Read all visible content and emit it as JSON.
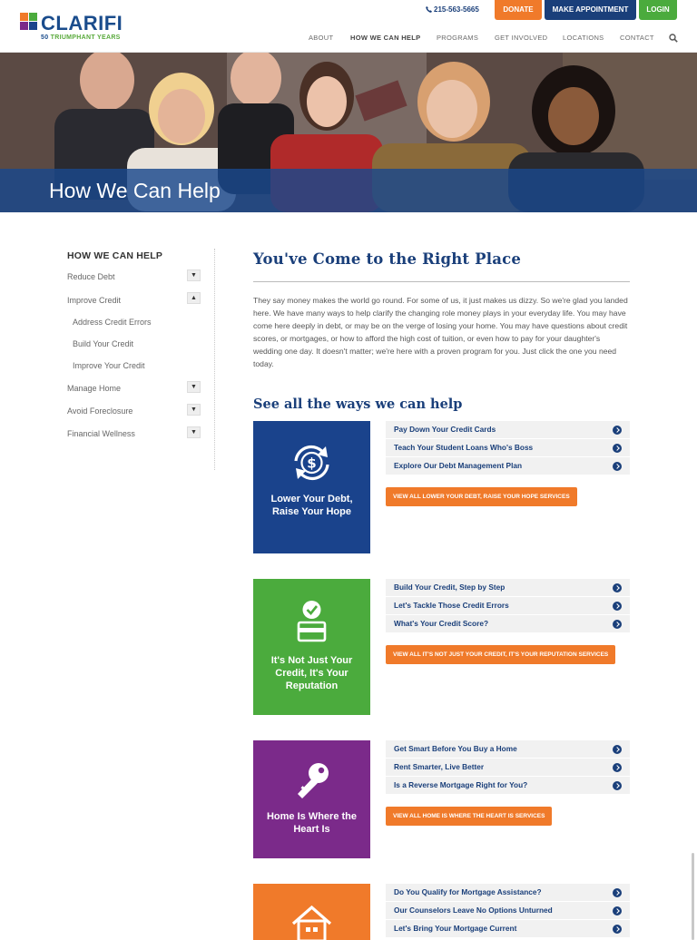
{
  "header": {
    "logo_text": "CLARIFI",
    "logo_sub_num": "50",
    "logo_sub_text": "TRIUMPHANT YEARS",
    "phone": "215-563-5665",
    "donate": "DONATE",
    "appointment": "MAKE APPOINTMENT",
    "login": "LOGIN",
    "nav": [
      "ABOUT",
      "HOW WE CAN HELP",
      "PROGRAMS",
      "GET INVOLVED",
      "LOCATIONS",
      "CONTACT"
    ],
    "colors": {
      "brand": "#1a3f7a",
      "orange": "#f07a2a",
      "green": "#4bab3d"
    }
  },
  "hero": {
    "title": "How We Can Help"
  },
  "sidebar": {
    "title": "HOW WE CAN HELP",
    "items": [
      {
        "label": "Reduce Debt",
        "toggle": "▼"
      },
      {
        "label": "Improve Credit",
        "toggle": "▲"
      },
      {
        "label": "Address Credit Errors"
      },
      {
        "label": "Build Your Credit"
      },
      {
        "label": "Improve Your Credit"
      },
      {
        "label": "Manage Home",
        "toggle": "▼"
      },
      {
        "label": "Avoid Foreclosure",
        "toggle": "▼"
      },
      {
        "label": "Financial Wellness",
        "toggle": "▼"
      }
    ]
  },
  "main": {
    "title": "You've Come to the Right Place",
    "intro": "They say money makes the world go round. For some of us, it just makes us dizzy. So we're glad you landed here. We have many ways to help clarify the changing role money plays in your everyday life. You may have come here deeply in debt, or may be on the verge of losing your home. You may have questions about credit scores, or mortgages, or how to afford the high cost of tuition, or even how to pay for your daughter's wedding one day. It doesn't matter; we're here with a proven program for you. Just click the one you need today.",
    "ways_title": "See all the ways we can help",
    "cards": [
      {
        "label": "Lower Your Debt, Raise Your Hope",
        "icon": "dollar-cycle-icon",
        "color": "#1a438c",
        "links": [
          "Pay Down Your Credit Cards",
          "Teach Your Student Loans Who's Boss",
          "Explore Our Debt Management Plan"
        ],
        "view_all": "VIEW ALL LOWER YOUR DEBT, RAISE YOUR HOPE SERVICES"
      },
      {
        "label": "It's Not Just Your Credit, It's Your Reputation",
        "icon": "credit-card-check-icon",
        "color": "#4bab3d",
        "links": [
          "Build Your Credit, Step by Step",
          "Let's Tackle Those Credit Errors",
          "What's Your Credit Score?"
        ],
        "view_all": "VIEW ALL IT'S NOT JUST YOUR CREDIT, IT'S YOUR REPUTATION SERVICES"
      },
      {
        "label": "Home Is Where the Heart Is",
        "icon": "key-icon",
        "color": "#7b2a8a",
        "links": [
          "Get Smart Before You Buy a Home",
          "Rent Smarter, Live Better",
          "Is a Reverse Mortgage Right for You?"
        ],
        "view_all": "VIEW ALL HOME IS WHERE THE HEART IS SERVICES"
      },
      {
        "label": "",
        "icon": "house-icon",
        "color": "#f07a2a",
        "links": [
          "Do You Qualify for Mortgage Assistance?",
          "Our Counselors Leave No Options Unturned",
          "Let's Bring Your Mortgage Current"
        ],
        "view_all": ""
      }
    ]
  }
}
